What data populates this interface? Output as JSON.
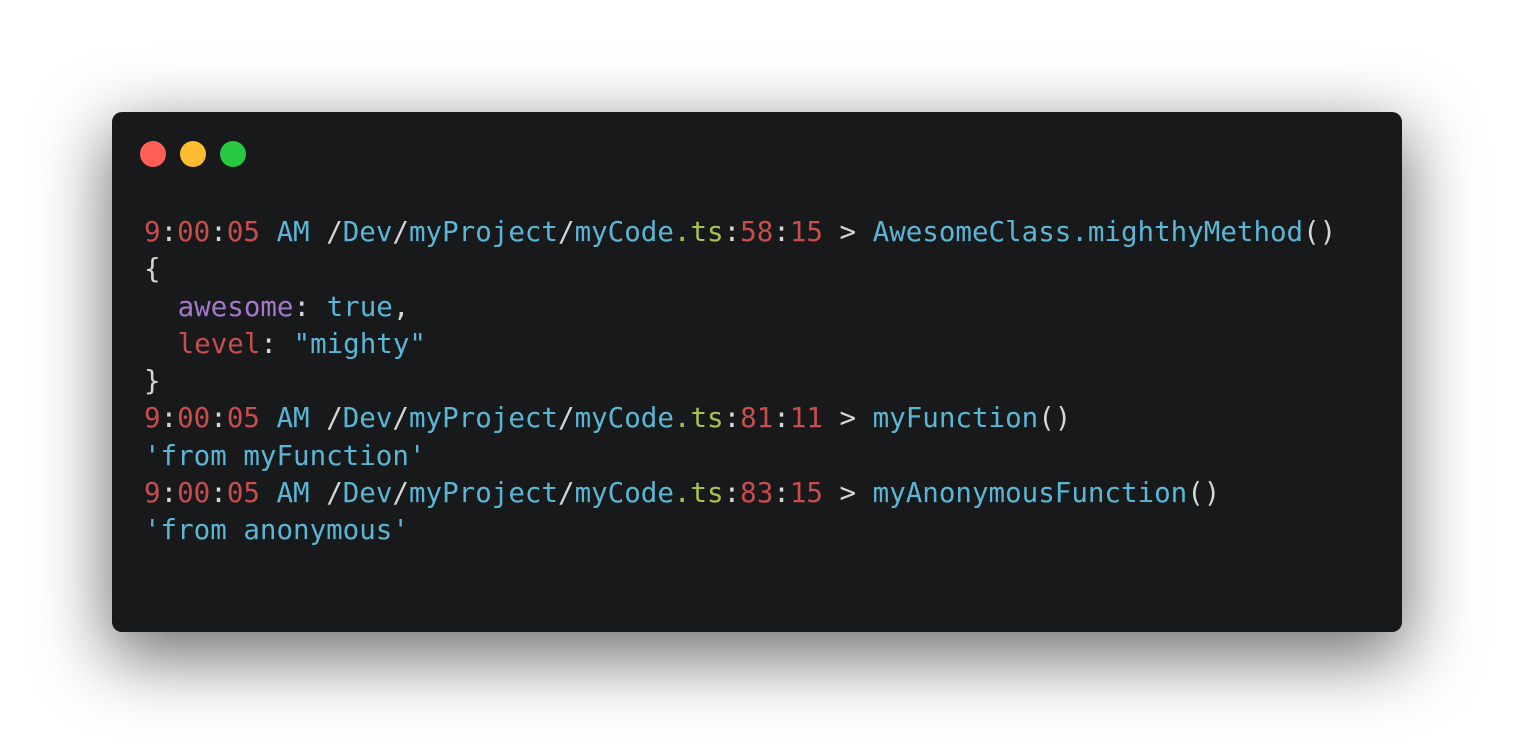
{
  "window": {
    "controls": [
      {
        "name": "close",
        "color": "#ff5f57"
      },
      {
        "name": "minimize",
        "color": "#febc2e"
      },
      {
        "name": "maximize",
        "color": "#28c840"
      }
    ]
  },
  "colors": {
    "background": "#18191b",
    "red": "#c94c4e",
    "blue": "#5bb6d6",
    "green": "#a6c24f",
    "purple": "#a277c9",
    "plain": "#d4d7d6"
  },
  "log": [
    {
      "type": "header",
      "hour": "9",
      "minute": "00",
      "second": "05",
      "meridiem": "AM",
      "path": [
        "Dev",
        "myProject"
      ],
      "file": "myCode",
      "ext": "ts",
      "line_no": "58",
      "col_no": "15",
      "caller": "AwesomeClass.mighthyMethod",
      "parens": "()"
    },
    {
      "type": "plain",
      "text": "{"
    },
    {
      "type": "prop",
      "key": "awesome",
      "key_color": "purple",
      "value": "true",
      "suffix": ","
    },
    {
      "type": "prop",
      "key": "level",
      "key_color": "red",
      "value": "\"mighty\"",
      "suffix": ""
    },
    {
      "type": "plain",
      "text": "}"
    },
    {
      "type": "header",
      "hour": "9",
      "minute": "00",
      "second": "05",
      "meridiem": "AM",
      "path": [
        "Dev",
        "myProject"
      ],
      "file": "myCode",
      "ext": "ts",
      "line_no": "81",
      "col_no": "11",
      "caller": "myFunction",
      "parens": "()"
    },
    {
      "type": "string",
      "text": "'from myFunction'"
    },
    {
      "type": "header",
      "hour": "9",
      "minute": "00",
      "second": "05",
      "meridiem": "AM",
      "path": [
        "Dev",
        "myProject"
      ],
      "file": "myCode",
      "ext": "ts",
      "line_no": "83",
      "col_no": "15",
      "caller": "myAnonymousFunction",
      "parens": "()"
    },
    {
      "type": "string",
      "text": "'from anonymous'"
    }
  ]
}
